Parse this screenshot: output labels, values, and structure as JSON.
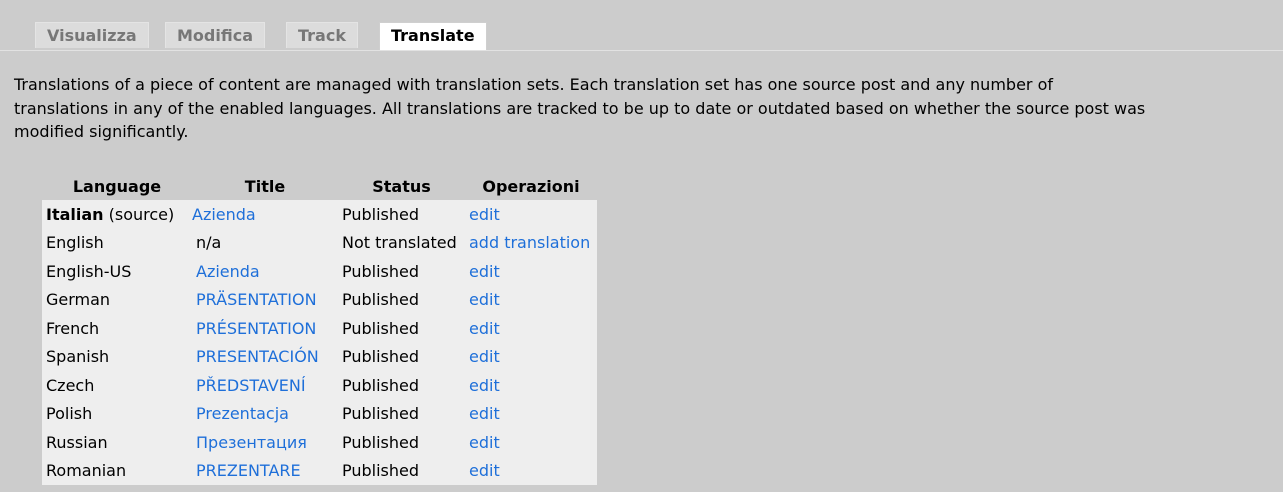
{
  "tabs": [
    {
      "label": "Visualizza",
      "active": false
    },
    {
      "label": "Modifica",
      "active": false
    },
    {
      "label": "Track",
      "active": false
    },
    {
      "label": "Translate",
      "active": true
    }
  ],
  "intro": {
    "line1": "Translations of a piece of content are managed with translation sets. Each translation set has one source post and any number of",
    "line2": "translations in any of the enabled languages. All translations are tracked to be up to date or outdated based on whether the source post was",
    "line3": "modified significantly."
  },
  "table": {
    "headers": {
      "language": "Language",
      "title": "Title",
      "status": "Status",
      "operations": "Operazioni"
    },
    "rows": [
      {
        "language": "Italian",
        "source_suffix": " (source)",
        "title": "Azienda",
        "title_link": true,
        "status": "Published",
        "operation": "edit"
      },
      {
        "language": "English",
        "title": "n/a",
        "title_link": false,
        "status": "Not translated",
        "operation": "add translation"
      },
      {
        "language": "English-US",
        "title": "Azienda",
        "title_link": true,
        "status": "Published",
        "operation": "edit"
      },
      {
        "language": "German",
        "title": "PRÄSENTATION",
        "title_link": true,
        "status": "Published",
        "operation": "edit"
      },
      {
        "language": "French",
        "title": "PRÉSENTATION",
        "title_link": true,
        "status": "Published",
        "operation": "edit"
      },
      {
        "language": "Spanish",
        "title": "PRESENTACIÓN",
        "title_link": true,
        "status": "Published",
        "operation": "edit"
      },
      {
        "language": "Czech",
        "title": "PŘEDSTAVENÍ",
        "title_link": true,
        "status": "Published",
        "operation": "edit"
      },
      {
        "language": "Polish",
        "title": "Prezentacja",
        "title_link": true,
        "status": "Published",
        "operation": "edit"
      },
      {
        "language": "Russian",
        "title": "Презентация",
        "title_link": true,
        "status": "Published",
        "operation": "edit"
      },
      {
        "language": "Romanian",
        "title": "PREZENTARE",
        "title_link": true,
        "status": "Published",
        "operation": "edit"
      }
    ]
  },
  "colors": {
    "background": "#cccccc",
    "link": "#1e6fd9",
    "table_cell": "#eeeeee",
    "active_tab": "#ffffff"
  }
}
